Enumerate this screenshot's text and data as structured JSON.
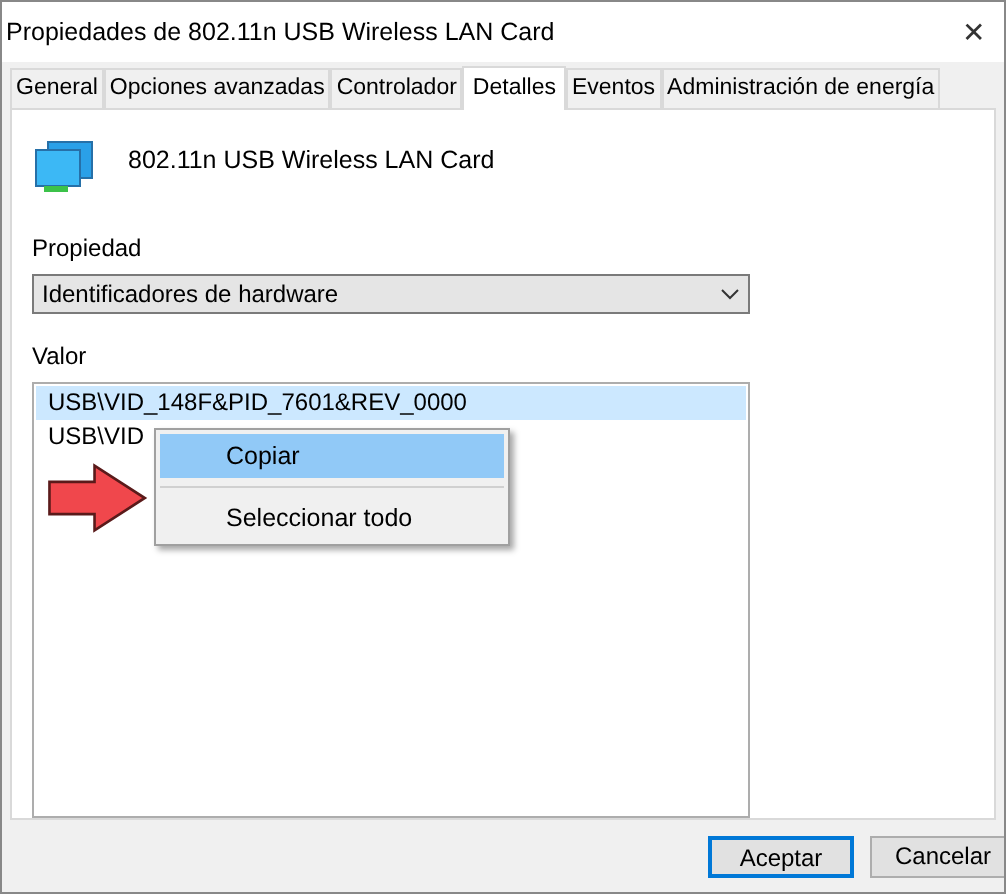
{
  "window": {
    "title": "Propiedades de 802.11n USB Wireless LAN Card",
    "close": "✕"
  },
  "tabs": [
    {
      "label": "General",
      "selected": false
    },
    {
      "label": "Opciones avanzadas",
      "selected": false
    },
    {
      "label": "Controlador",
      "selected": false
    },
    {
      "label": "Detalles",
      "selected": true
    },
    {
      "label": "Eventos",
      "selected": false
    },
    {
      "label": "Administración de energía",
      "selected": false
    }
  ],
  "device": {
    "name": "802.11n USB Wireless LAN Card"
  },
  "property": {
    "label": "Propiedad",
    "value": "Identificadores de hardware"
  },
  "values": {
    "label": "Valor",
    "rows": [
      {
        "text": "USB\\VID_148F&PID_7601&REV_0000",
        "selected": true
      },
      {
        "text": "USB\\VID",
        "selected": false
      }
    ]
  },
  "context_menu": [
    {
      "label": "Copiar",
      "selected": true
    },
    {
      "label": "Seleccionar todo",
      "selected": false
    }
  ],
  "buttons": [
    {
      "label": "Aceptar",
      "default": true
    },
    {
      "label": "Cancelar",
      "default": false
    }
  ]
}
